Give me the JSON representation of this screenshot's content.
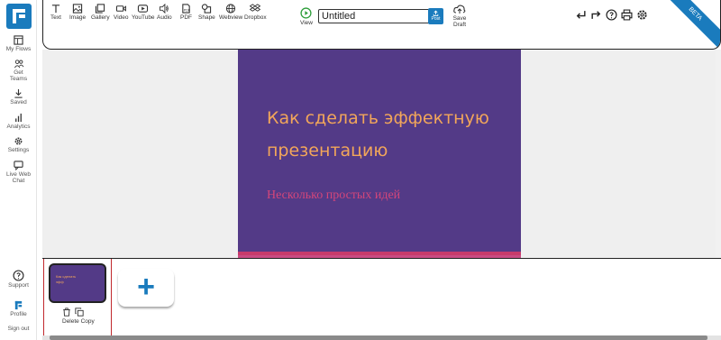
{
  "sidebar": {
    "items": [
      {
        "label": "My Flows"
      },
      {
        "label": "Get Teams"
      },
      {
        "label": "Saved"
      },
      {
        "label": "Analytics"
      },
      {
        "label": "Settings"
      },
      {
        "label": "Live Web Chat"
      }
    ],
    "bottom": [
      {
        "label": "Support"
      },
      {
        "label": "Profile"
      },
      {
        "label": "Sign out"
      }
    ]
  },
  "toolbar": {
    "tools": [
      "Text",
      "Image",
      "Gallery",
      "Video",
      "YouTube",
      "Audio",
      "PDF",
      "Shape",
      "Webview",
      "Dropbox"
    ],
    "view_label": "View",
    "title_value": "Untitled",
    "post_label": "Post",
    "save_draft_label": "Save Draft",
    "beta_label": "BETA"
  },
  "slide": {
    "title": "Как сделать эффектную презентацию",
    "subtitle": "Несколько простых идей"
  },
  "thumbnail": {
    "title": "Как сделать эфф",
    "delete_label": "Delete",
    "copy_label": "Copy"
  },
  "add_button": "+",
  "colors": {
    "accent": "#1a7bbd",
    "slide_bg": "#533a87",
    "slide_title": "#f2a65a",
    "slide_sub": "#d4467a"
  }
}
